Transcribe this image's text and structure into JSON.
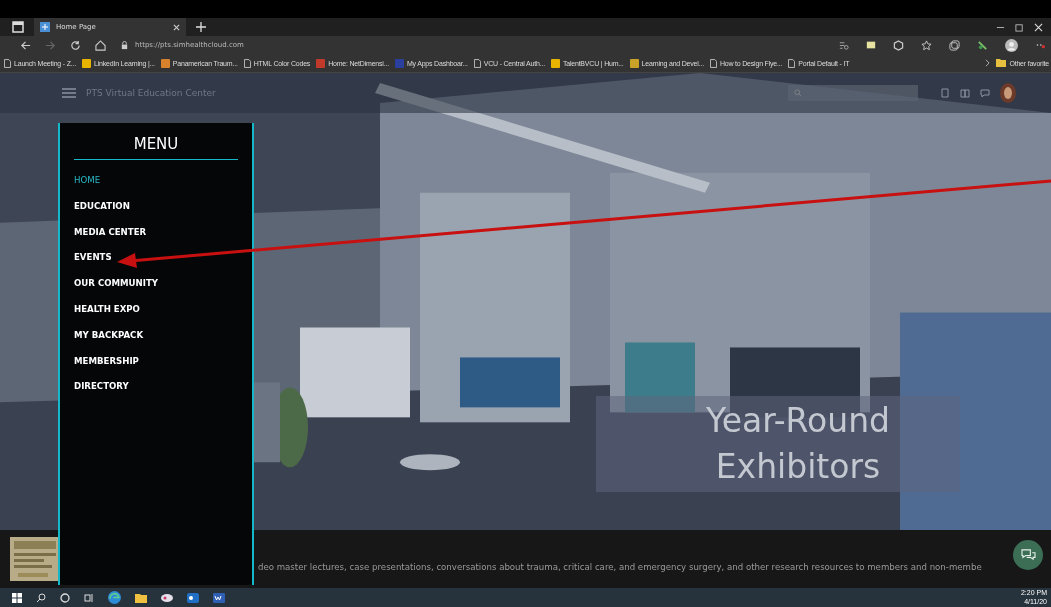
{
  "browser": {
    "tab": {
      "title": "Home Page",
      "selected": true
    },
    "address": "https://pts.simhealthcloud.com",
    "bookmarks": [
      {
        "label": "Launch Meeting - Z...",
        "kind": "page"
      },
      {
        "label": "LinkedIn Learning |...",
        "kind": "site",
        "color": "#e8b400"
      },
      {
        "label": "Panamerican Traum...",
        "kind": "site",
        "color": "#d9822b"
      },
      {
        "label": "HTML Color Codes",
        "kind": "page"
      },
      {
        "label": "Home: NetDimensi...",
        "kind": "site",
        "color": "#c0392b"
      },
      {
        "label": "My Apps Dashboar...",
        "kind": "site",
        "color": "#2b3f9e"
      },
      {
        "label": "VCU - Central Auth...",
        "kind": "page"
      },
      {
        "label": "TalentBVCU | Hum...",
        "kind": "site",
        "color": "#e8b400"
      },
      {
        "label": "Learning and Devel...",
        "kind": "site",
        "color": "#c9a227"
      },
      {
        "label": "How to Design Flye...",
        "kind": "page"
      },
      {
        "label": "Portal Default - IT",
        "kind": "page"
      }
    ],
    "other_favorites": "Other favorite"
  },
  "site": {
    "title": "PTS Virtual Education Center"
  },
  "menu": {
    "title": "MENU",
    "items": [
      {
        "label": "HOME",
        "selected": true
      },
      {
        "label": "EDUCATION",
        "selected": false
      },
      {
        "label": "MEDIA CENTER",
        "selected": false
      },
      {
        "label": "EVENTS",
        "selected": false
      },
      {
        "label": "OUR COMMUNITY",
        "selected": false
      },
      {
        "label": "HEALTH EXPO",
        "selected": false
      },
      {
        "label": "MY BACKPACK",
        "selected": false
      },
      {
        "label": "MEMBERSHIP",
        "selected": false
      },
      {
        "label": "DIRECTORY",
        "selected": false
      }
    ]
  },
  "banner": {
    "lines": [
      "Year-Round",
      "Exhibitors"
    ]
  },
  "footer": {
    "text": "deo master lectures, case presentations, conversations about trauma, critical care, and emergency surgery, and other research resources to members and non-membe"
  },
  "taskbar": {
    "time": "2:20 PM",
    "date": "4/11/20"
  }
}
